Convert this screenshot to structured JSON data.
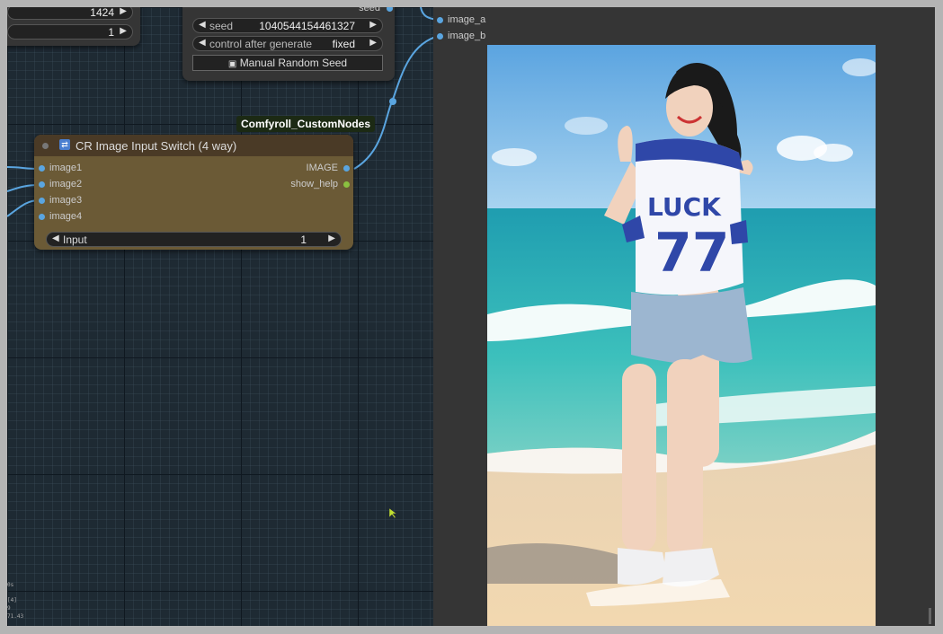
{
  "top_left_node": {
    "rows": [
      {
        "value": "1424"
      },
      {
        "value": "1"
      }
    ]
  },
  "seed_node": {
    "output_label": "seed",
    "seed_label": "seed",
    "seed_value": "1040544154461327",
    "control_label": "control after generate",
    "control_value": "fixed",
    "button_label": "Manual Random Seed"
  },
  "tag": {
    "label": "Comfyroll_CustomNodes"
  },
  "cr_node": {
    "title": "CR Image Input Switch (4 way)",
    "inputs": [
      "image1",
      "image2",
      "image3",
      "image4"
    ],
    "outputs": [
      "IMAGE",
      "show_help"
    ],
    "input_widget": {
      "label": "Input",
      "value": "1"
    }
  },
  "preview": {
    "inputs": [
      "image_a",
      "image_b"
    ],
    "shirt_text": "LUCK",
    "shirt_number": "77"
  },
  "corner_stats": [
    "0s",
    "[4]",
    "9",
    "71.43"
  ],
  "colors": {
    "image_port": "#5aa5e0",
    "help_port": "#8ac040",
    "wire": "#5aa5e0"
  }
}
